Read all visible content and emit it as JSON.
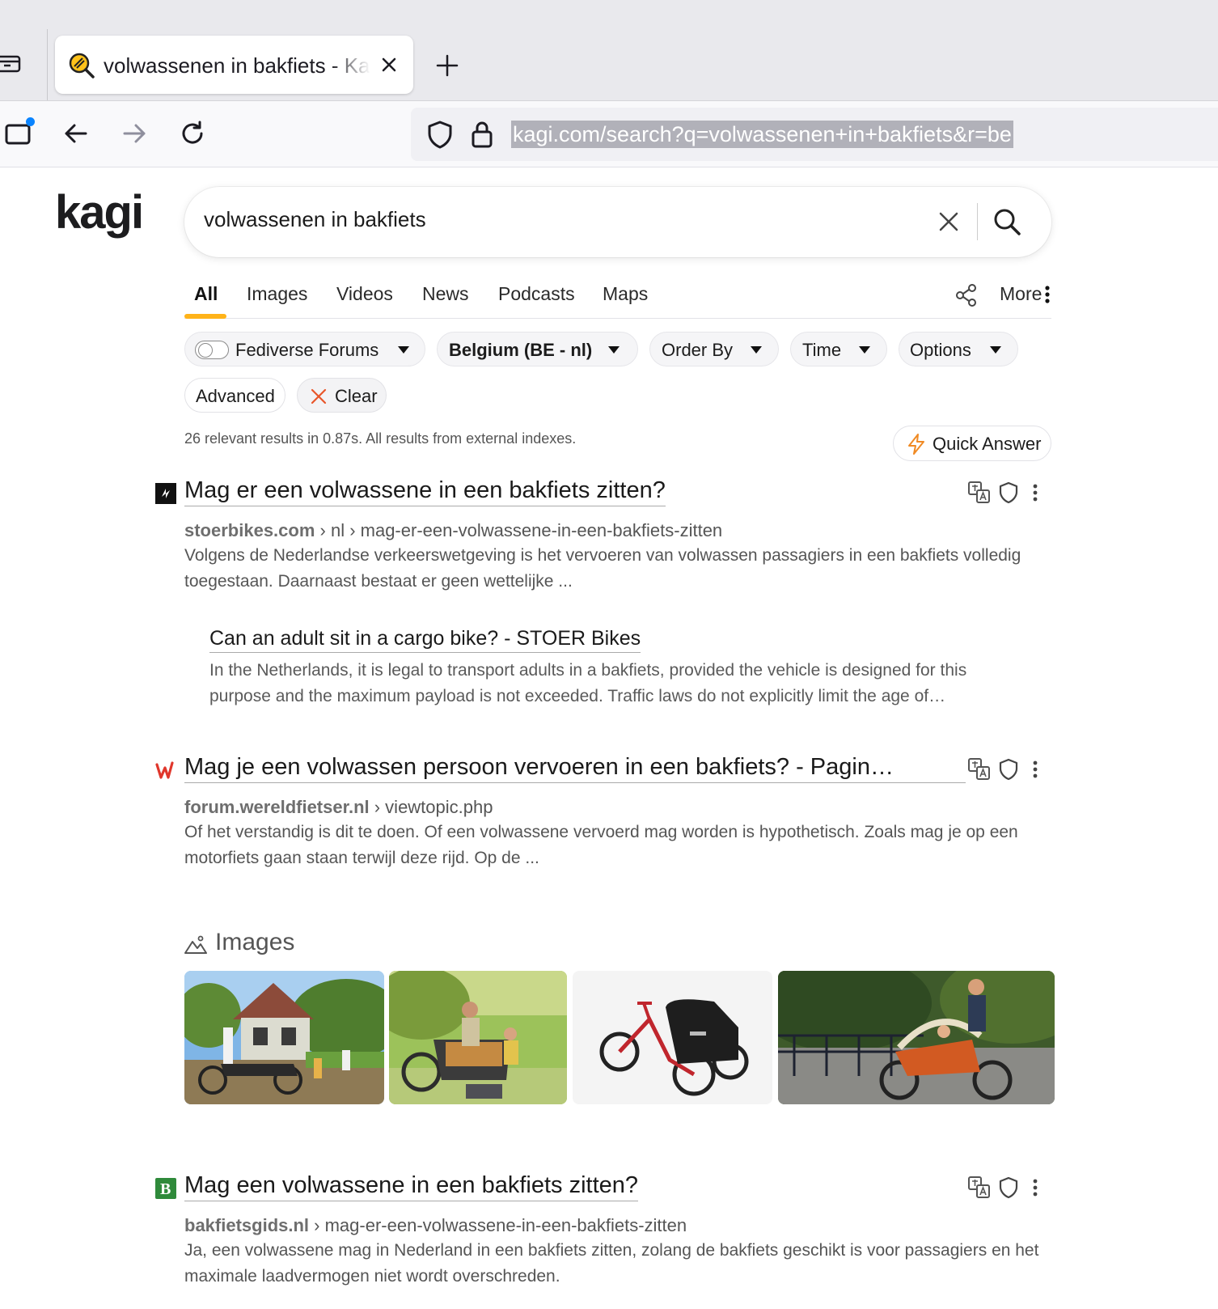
{
  "browser": {
    "tab_title": "volwassenen in bakfiets - Kagi Search",
    "url": "kagi.com/search?q=volwassenen+in+bakfiets&r=be"
  },
  "search": {
    "query": "volwassenen in bakfiets"
  },
  "tabs": [
    {
      "label": "All",
      "active": true
    },
    {
      "label": "Images"
    },
    {
      "label": "Videos"
    },
    {
      "label": "News"
    },
    {
      "label": "Podcasts"
    },
    {
      "label": "Maps"
    }
  ],
  "more_label": "More",
  "filters": {
    "fediverse": "Fediverse Forums",
    "region": "Belgium (BE - nl)",
    "order_by": "Order By",
    "time": "Time",
    "options": "Options",
    "advanced": "Advanced",
    "clear": "Clear"
  },
  "stats": "26 relevant results in 0.87s. All results from external indexes.",
  "quick_answer": "Quick Answer",
  "results": [
    {
      "title": "Mag er een volwassene in een bakfiets zitten?",
      "domain": "stoerbikes.com",
      "path": " › nl › mag-er-een-volwassene-in-een-bakfiets-zitten",
      "snippet": "Volgens de Nederlandse verkeerswetgeving is het vervoeren van volwassen passagiers in een bakfiets volledig toegestaan. Daarnaast bestaat er geen wettelijke ...",
      "sub_title": "Can an adult sit in a cargo bike? - STOER Bikes",
      "sub_snippet": "In the Netherlands, it is legal to transport adults in a bakfiets, provided the vehicle is designed for this purpose and the maximum payload is not exceeded. Traffic laws do not explicitly limit the age of…"
    },
    {
      "title": "Mag je een volwassen persoon vervoeren in een bakfiets? - Pagin…",
      "domain": "forum.wereldfietser.nl",
      "path": " › viewtopic.php",
      "snippet": "Of het verstandig is dit te doen. Of een volwassene vervoerd mag worden is hypothetisch. Zoals mag je op een motorfiets gaan staan terwijl deze rijd. Op de ..."
    },
    {
      "title": "Mag een volwassene in een bakfiets zitten?",
      "domain": "bakfietsgids.nl",
      "path": " › mag-er-een-volwassene-in-een-bakfiets-zitten",
      "snippet": "Ja, een volwassene mag in Nederland in een bakfiets zitten, zolang de bakfiets geschikt is voor passagiers en het maximale laadvermogen niet wordt overschreden."
    }
  ],
  "images_label": "Images",
  "colors": {
    "accent": "#ffb319",
    "clear_x": "#e8562a",
    "bolt": "#f08a24"
  }
}
